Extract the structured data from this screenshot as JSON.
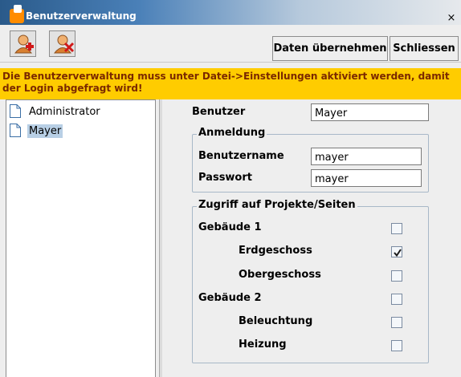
{
  "window": {
    "title": "Benutzerverwaltung",
    "close_symbol": "×"
  },
  "toolbar": {
    "add_user_icon": "add-user-icon",
    "remove_user_icon": "remove-user-icon",
    "apply_label": "Daten übernehmen",
    "close_label": "Schliessen"
  },
  "warning": {
    "text": "Die Benutzerverwaltung muss unter Datei->Einstellungen aktiviert werden, damit der Login abgefragt wird!"
  },
  "tree": {
    "items": [
      {
        "label": "Administrator",
        "selected": false
      },
      {
        "label": "Mayer",
        "selected": true
      }
    ]
  },
  "form": {
    "user_label": "Benutzer",
    "user_value": "Mayer",
    "login_group": "Anmeldung",
    "username_label": "Benutzername",
    "username_value": "mayer",
    "password_label": "Passwort",
    "password_value": "mayer",
    "access_group": "Zugriff auf Projekte/Seiten",
    "access": [
      {
        "label": "Gebäude 1",
        "checked": false
      },
      {
        "label": "Erdgeschoss",
        "checked": true
      },
      {
        "label": "Obergeschoss",
        "checked": false
      },
      {
        "label": "Gebäude 2",
        "checked": false
      },
      {
        "label": "Beleuchtung",
        "checked": false
      },
      {
        "label": "Heizung",
        "checked": false
      }
    ]
  },
  "colors": {
    "warning_bg": "#ffcc00",
    "warning_text": "#7a2800",
    "selection": "#b8cfe5",
    "title_bar": "#2a5a8a"
  }
}
